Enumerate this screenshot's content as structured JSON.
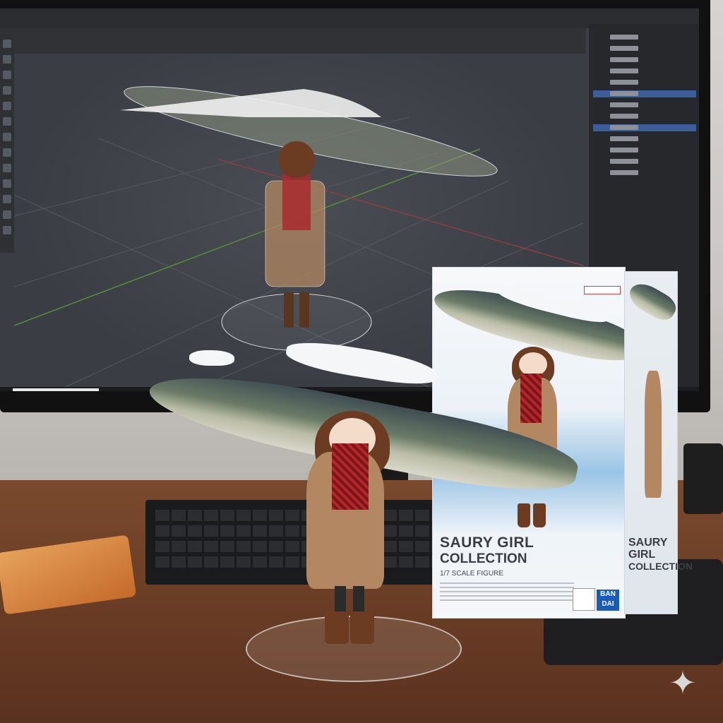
{
  "box": {
    "title": "SAURY GIRL",
    "subtitle": "COLLECTION",
    "scale": "1/7 SCALE FIGURE",
    "side_title_1": "SAURY GIRL",
    "side_title_2": "COLLECTION",
    "brand": "BAN DAI"
  },
  "colors": {
    "viewport_bg": "#3a3d44",
    "outliner_selection": "#3d5e9a",
    "desk": "#6a3d25",
    "scarf": "#b3262a",
    "coat": "#b28762"
  },
  "icons": [
    "sparkle-icon"
  ]
}
